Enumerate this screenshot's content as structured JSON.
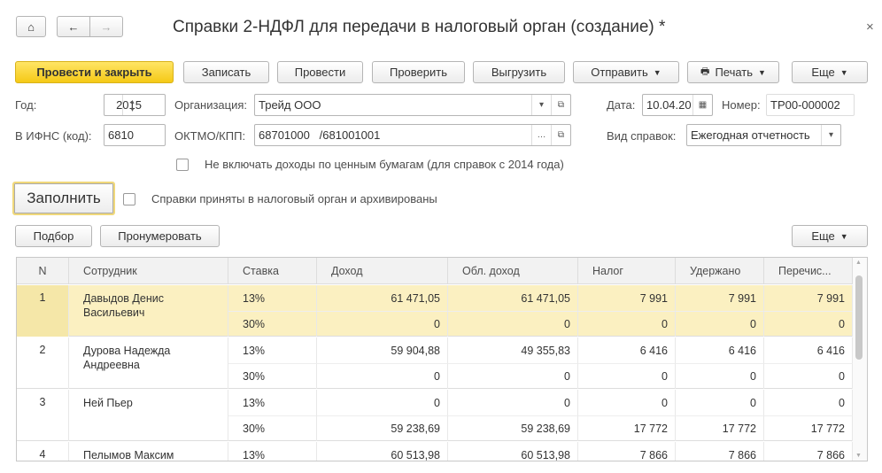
{
  "title": "Справки 2-НДФЛ для передачи в налоговый орган (создание) *",
  "nav": {
    "home": "⌂",
    "back": "←",
    "forward": "→",
    "close": "×"
  },
  "toolbar": {
    "post_close": "Провести и закрыть",
    "save": "Записать",
    "post": "Провести",
    "check": "Проверить",
    "export": "Выгрузить",
    "send": "Отправить",
    "print": "Печать",
    "more": "Еще"
  },
  "form": {
    "year_label": "Год:",
    "year": "2015",
    "org_label": "Организация:",
    "org": "Трейд ООО",
    "date_label": "Дата:",
    "date": "10.04.20",
    "number_label": "Номер:",
    "number": "ТР00-000002",
    "ifns_label": "В ИФНС (код):",
    "ifns": "6810",
    "oktmo_label": "ОКТМО/КПП:",
    "oktmo": "68701000   /681001001",
    "type_label": "Вид справок:",
    "type": "Ежегодная отчетность",
    "exclude_label": "Не включать доходы по ценным бумагам (для справок с 2014 года)",
    "archived_label": "Справки приняты в налоговый орган и архивированы",
    "fill": "Заполнить"
  },
  "table_toolbar": {
    "pick": "Подбор",
    "renumber": "Пронумеровать",
    "more": "Еще"
  },
  "table": {
    "headers": [
      "N",
      "Сотрудник",
      "Ставка",
      "Доход",
      "Обл. доход",
      "Налог",
      "Удержано",
      "Перечис..."
    ],
    "rows": [
      {
        "n": "1",
        "name": "Давыдов Денис Васильевич",
        "selected": true,
        "rates": [
          [
            "13%",
            "61 471,05",
            "61 471,05",
            "7 991",
            "7 991",
            "7 991"
          ],
          [
            "30%",
            "0",
            "0",
            "0",
            "0",
            "0"
          ]
        ]
      },
      {
        "n": "2",
        "name": "Дурова Надежда Андреевна",
        "rates": [
          [
            "13%",
            "59 904,88",
            "49 355,83",
            "6 416",
            "6 416",
            "6 416"
          ],
          [
            "30%",
            "0",
            "0",
            "0",
            "0",
            "0"
          ]
        ]
      },
      {
        "n": "3",
        "name": "Ней Пьер",
        "rates": [
          [
            "13%",
            "0",
            "0",
            "0",
            "0",
            "0"
          ],
          [
            "30%",
            "59 238,69",
            "59 238,69",
            "17 772",
            "17 772",
            "17 772"
          ]
        ]
      },
      {
        "n": "4",
        "name": "Пелымов Максим",
        "rates": [
          [
            "13%",
            "60 513,98",
            "60 513,98",
            "7 866",
            "7 866",
            "7 866"
          ]
        ]
      }
    ]
  }
}
